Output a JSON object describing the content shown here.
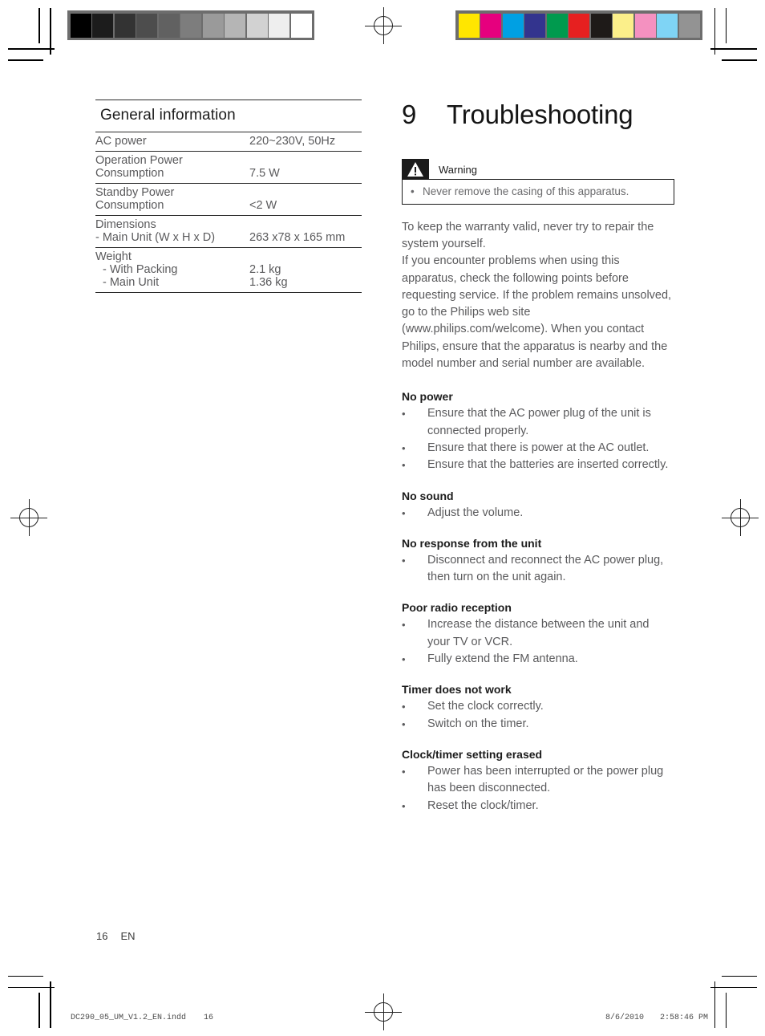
{
  "document": {
    "page_number": "16",
    "language_code": "EN",
    "imprint_file": "DC290_05_UM_V1.2_EN.indd",
    "imprint_page": "16",
    "imprint_date": "8/6/2010",
    "imprint_time": "2:58:46 PM"
  },
  "calibration": {
    "grayscale_swatches": [
      "#000000",
      "#1c1c1c",
      "#333333",
      "#4d4d4d",
      "#616161",
      "#7d7d7d",
      "#9a9a9a",
      "#b5b5b5",
      "#d2d2d2",
      "#eeeeee",
      "#ffffff"
    ],
    "color_swatches": [
      "#ffe600",
      "#e6007e",
      "#00a0e3",
      "#33348e",
      "#009a4e",
      "#e62020",
      "#1e1a18",
      "#fbef8a",
      "#f491c0",
      "#7fd4f5",
      "#939393"
    ],
    "registration_icon": "registration-target-icon"
  },
  "spec_table": {
    "title": "General information",
    "rows": [
      {
        "key": "AC power",
        "key_line2": "",
        "value": "220~230V, 50Hz"
      },
      {
        "key": "Operation Power",
        "key_line2": "Consumption",
        "value": "7.5 W"
      },
      {
        "key": "Standby Power",
        "key_line2": "Consumption",
        "value": "<2 W"
      },
      {
        "key": "Dimensions",
        "key_line2": "- Main Unit (W x H x D)",
        "value": "263 x78 x 165 mm"
      },
      {
        "key": "Weight",
        "key_line2": "",
        "value": ""
      }
    ],
    "weight_rows": [
      {
        "key": " - With Packing",
        "value": "2.1 kg"
      },
      {
        "key": " - Main Unit",
        "value": "1.36 kg"
      }
    ]
  },
  "chapter": {
    "number": "9",
    "title": "Troubleshooting"
  },
  "warning": {
    "icon": "warning-triangle-icon",
    "label": "Warning",
    "bullet_glyph": "•",
    "text": "Never remove the casing of this apparatus."
  },
  "intro": {
    "paragraph1": "To keep the warranty valid, never try to repair the system yourself.",
    "paragraph2": "If you encounter problems when using this apparatus, check the following points before requesting service. If the problem remains unsolved, go to the Philips web site (www.philips.com/welcome). When you contact Philips, ensure that the apparatus is nearby and the model number and serial number are available."
  },
  "bullet_glyph": "•",
  "sections": [
    {
      "heading": "No power",
      "items": [
        "Ensure that the AC power plug of the unit is connected properly.",
        "Ensure that there is power at the AC outlet.",
        "Ensure that the batteries are inserted correctly."
      ]
    },
    {
      "heading": "No sound",
      "items": [
        "Adjust the volume."
      ]
    },
    {
      "heading": "No response from the unit",
      "items": [
        "Disconnect and reconnect the AC power plug, then turn on the unit again."
      ]
    },
    {
      "heading": "Poor radio reception",
      "items": [
        "Increase the distance between the unit and your TV or VCR.",
        "Fully extend the FM antenna."
      ]
    },
    {
      "heading": "Timer does not work",
      "items": [
        "Set the clock correctly.",
        "Switch on the timer."
      ]
    },
    {
      "heading": "Clock/timer setting erased",
      "items": [
        "Power has been interrupted or the power plug has been disconnected.",
        "Reset the clock/timer."
      ]
    }
  ]
}
